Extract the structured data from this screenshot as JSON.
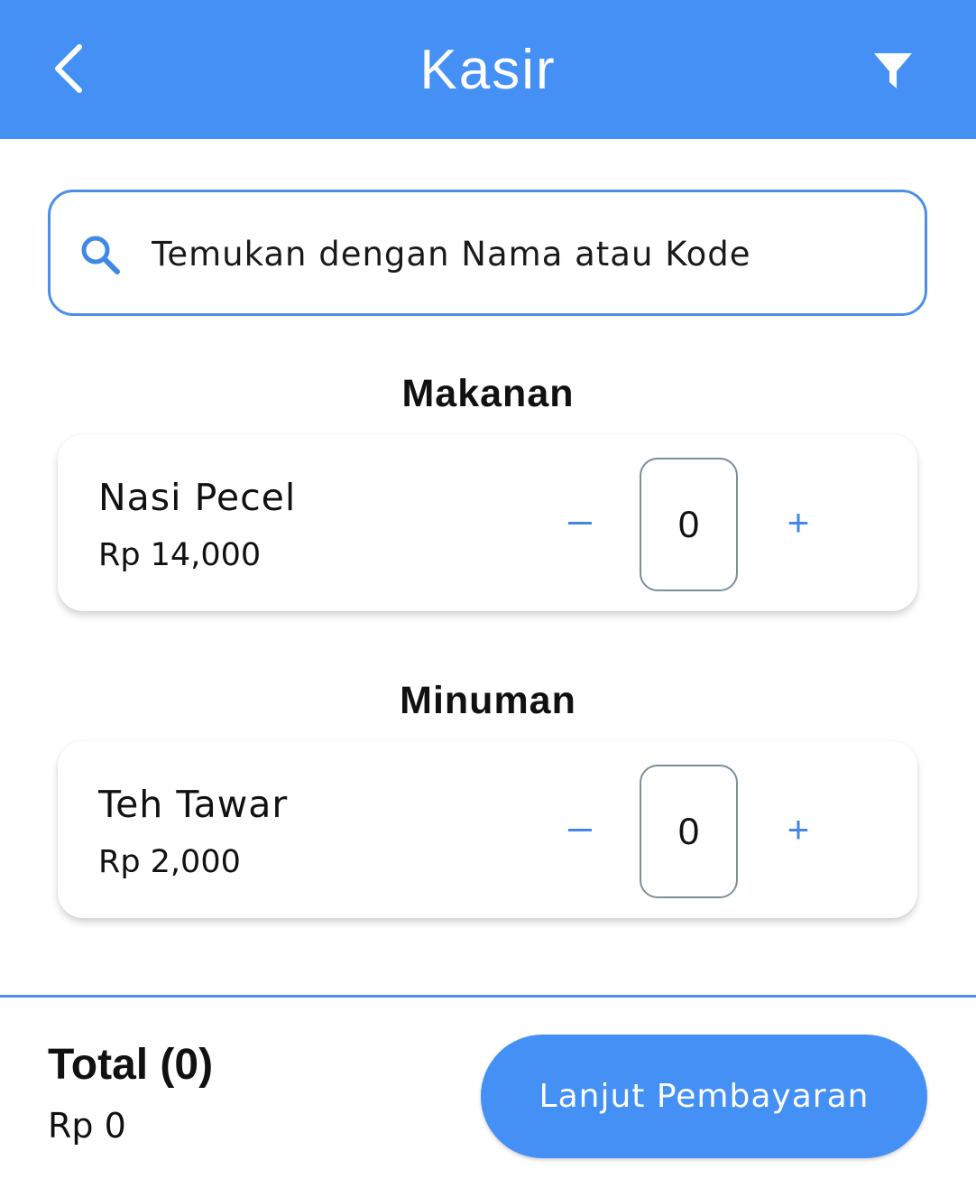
{
  "appbar": {
    "title": "Kasir",
    "back_icon": "chevron-left-icon",
    "filter_icon": "filter-icon",
    "background": "#4490f5"
  },
  "search": {
    "placeholder": "Temukan dengan Nama atau Kode",
    "value": "",
    "icon": "search-icon"
  },
  "sections": [
    {
      "title": "Makanan",
      "items": [
        {
          "name": "Nasi Pecel",
          "price": "Rp 14,000",
          "quantity": "0",
          "minus_label": "−",
          "plus_label": "+"
        }
      ]
    },
    {
      "title": "Minuman",
      "items": [
        {
          "name": "Teh Tawar",
          "price": "Rp 2,000",
          "quantity": "0",
          "minus_label": "−",
          "plus_label": "+"
        }
      ]
    }
  ],
  "footer": {
    "total_label": "Total (0)",
    "total_amount": "Rp 0",
    "pay_button_label": "Lanjut Pembayaran"
  },
  "colors": {
    "primary": "#4490f5",
    "accent": "#3f88e6",
    "qty_border": "#7c8f99"
  }
}
